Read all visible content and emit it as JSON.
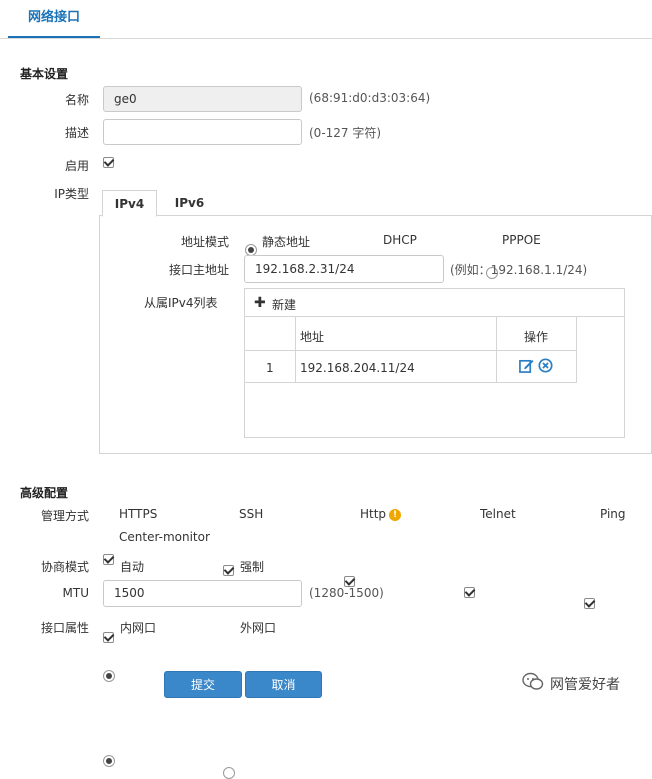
{
  "header": {
    "tab_label": "网络接口"
  },
  "basic": {
    "section_title": "基本设置",
    "name_label": "名称",
    "name_value": "ge0",
    "name_hint": "(68:91:d0:d3:03:64)",
    "desc_label": "描述",
    "desc_value": "",
    "desc_hint": "(0-127 字符)",
    "enable_label": "启用",
    "enable_checked": true,
    "iptype_label": "IP类型"
  },
  "ip_tabs": [
    {
      "label": "IPv4",
      "active": true
    },
    {
      "label": "IPv6",
      "active": false
    }
  ],
  "ipv4": {
    "addr_mode_label": "地址模式",
    "modes": [
      {
        "label": "静态地址",
        "checked": true
      },
      {
        "label": "DHCP",
        "checked": false
      },
      {
        "label": "PPPOE",
        "checked": false
      }
    ],
    "primary_label": "接口主地址",
    "primary_value": "192.168.2.31/24",
    "primary_hint": "(例如：192.168.1.1/24)",
    "secondary_label": "从属IPv4列表",
    "new_label": "新建",
    "columns": {
      "address": "地址",
      "action": "操作"
    },
    "rows": [
      {
        "index": "1",
        "address": "192.168.204.11/24"
      }
    ]
  },
  "advanced": {
    "section_title": "高级配置",
    "mgmt_label": "管理方式",
    "mgmt": [
      {
        "label": "HTTPS",
        "checked": true
      },
      {
        "label": "SSH",
        "checked": true
      },
      {
        "label": "Http",
        "checked": true
      },
      {
        "label": "Telnet",
        "checked": true
      },
      {
        "label": "Ping",
        "checked": true
      },
      {
        "label": "Center-monitor",
        "checked": true
      }
    ],
    "nego_label": "协商模式",
    "nego": [
      {
        "label": "自动",
        "checked": true
      },
      {
        "label": "强制",
        "checked": false
      }
    ],
    "mtu_label": "MTU",
    "mtu_value": "1500",
    "mtu_hint": "(1280-1500)",
    "attr_label": "接口属性",
    "attr": [
      {
        "label": "内网口",
        "checked": true
      },
      {
        "label": "外网口",
        "checked": false
      }
    ]
  },
  "buttons": {
    "submit": "提交",
    "cancel": "取消"
  },
  "watermark": {
    "text": "网管爱好者"
  },
  "colors": {
    "accent": "#1a73b8",
    "button": "#3a87c9",
    "warning": "#f0a800",
    "icon": "#2a7fc4"
  }
}
